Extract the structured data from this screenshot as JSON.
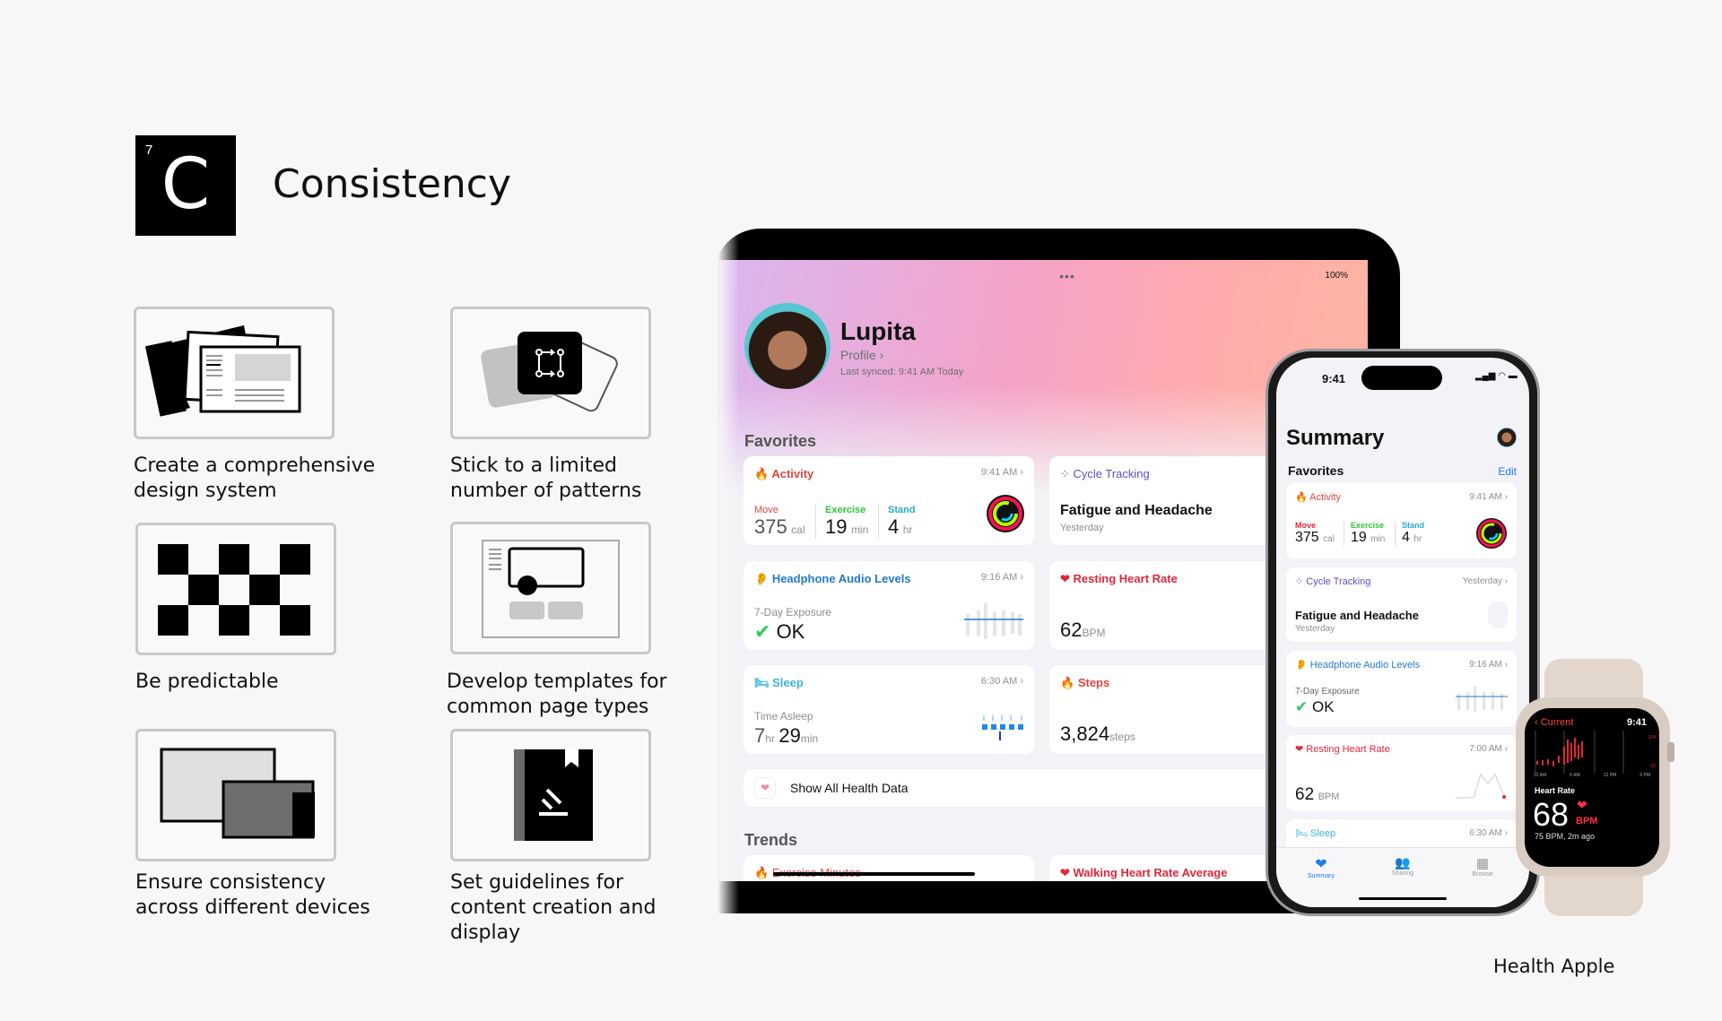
{
  "header": {
    "logo_number": "7",
    "logo_letter": "C",
    "title": "Consistency"
  },
  "principles": [
    {
      "label": "Create a comprehensive design system",
      "icon": "layered-documents-icon"
    },
    {
      "label": "Stick to a limited number of patterns",
      "icon": "pattern-cards-icon"
    },
    {
      "label": "Be predictable",
      "icon": "checkerboard-icon"
    },
    {
      "label": "Develop templates for common page types",
      "icon": "page-template-icon"
    },
    {
      "label": "Ensure consistency across different devices",
      "icon": "multi-device-icon"
    },
    {
      "label": "Set guidelines for content creation and display",
      "icon": "guideline-book-icon"
    }
  ],
  "ipad": {
    "battery": "100%",
    "name": "Lupita",
    "profile": "Profile",
    "synced": "Last synced: 9:41 AM Today",
    "favorites": "Favorites",
    "activity": {
      "title": "Activity",
      "time": "9:41 AM",
      "move_label": "Move",
      "move": "375",
      "move_unit": "cal",
      "exercise_label": "Exercise",
      "exercise": "19",
      "exercise_unit": "min",
      "stand_label": "Stand",
      "stand": "4",
      "stand_unit": "hr"
    },
    "cycle": {
      "title": "Cycle Tracking",
      "value": "Fatigue and Headache",
      "sub": "Yesterday"
    },
    "headphone": {
      "title": "Headphone Audio Levels",
      "time": "9:16 AM",
      "label": "7-Day Exposure",
      "value": "OK"
    },
    "resting": {
      "title": "Resting Heart Rate",
      "value": "62",
      "unit": "BPM"
    },
    "sleep": {
      "title": "Sleep",
      "time": "6:30 AM",
      "label": "Time Asleep",
      "hr": "7",
      "hr_unit": "hr",
      "min": "29",
      "min_unit": "min"
    },
    "steps": {
      "title": "Steps",
      "value": "3,824",
      "unit": "steps"
    },
    "show_all": "Show All Health Data",
    "trends": "Trends",
    "trend1": "Exercise Minutes",
    "trend2": "Walking Heart Rate Average"
  },
  "iphone": {
    "time": "9:41",
    "title": "Summary",
    "favorites": "Favorites",
    "edit": "Edit",
    "activity": {
      "title": "Activity",
      "time": "9:41 AM",
      "move_label": "Move",
      "move": "375",
      "move_unit": "cal",
      "exercise_label": "Exercise",
      "exercise": "19",
      "exercise_unit": "min",
      "stand_label": "Stand",
      "stand": "4",
      "stand_unit": "hr"
    },
    "cycle": {
      "title": "Cycle Tracking",
      "time": "Yesterday",
      "value": "Fatigue and Headache",
      "sub": "Yesterday"
    },
    "headphone": {
      "title": "Headphone Audio Levels",
      "time": "9:16 AM",
      "label": "7-Day Exposure",
      "value": "OK"
    },
    "resting": {
      "title": "Resting Heart Rate",
      "time": "7:00 AM",
      "value": "62",
      "unit": "BPM"
    },
    "sleep": {
      "title": "Sleep",
      "time": "6:30 AM"
    },
    "tabs": [
      {
        "label": "Summary",
        "active": true
      },
      {
        "label": "Sharing"
      },
      {
        "label": "Browse"
      }
    ]
  },
  "watch": {
    "back": "Current",
    "time": "9:41",
    "axis": [
      "12 AM",
      "6 AM",
      "12 PM",
      "6 PM"
    ],
    "ymax": "104",
    "ymin": "52",
    "label": "Heart Rate",
    "value": "68",
    "unit": "BPM",
    "sub": "75 BPM, 2m ago"
  },
  "credit": "Health Apple",
  "colors": {
    "activity": "#e0463d",
    "exercise": "#2fc63c",
    "stand": "#2aa9c9",
    "cycle": "#5b4fc4",
    "headphone": "#2479c9",
    "heart": "#e0283a",
    "accent": "#1f7bf2"
  }
}
